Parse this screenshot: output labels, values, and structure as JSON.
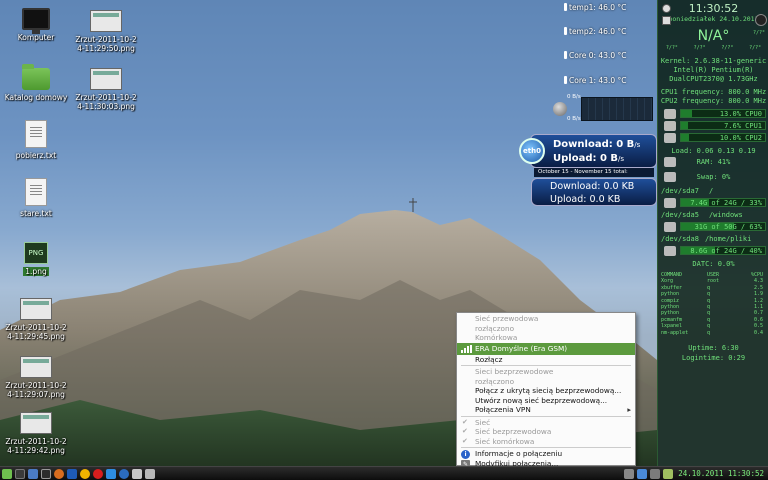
{
  "desktop": {
    "icons": [
      {
        "label": "Komputer"
      },
      {
        "label": "Zrzut-2011-10-2\n4-11:29:50.png"
      },
      {
        "label": "Katalog domowy"
      },
      {
        "label": "Zrzut-2011-10-2\n4-11:30:03.png"
      },
      {
        "label": "pobierz.txt"
      },
      {
        "label": "stare.txt"
      },
      {
        "label": "1.png",
        "badge": "PNG"
      },
      {
        "label": "Zrzut-2011-10-2\n4-11:29:45.png"
      },
      {
        "label": "Zrzut-2011-10-2\n4-11:29:07.png"
      },
      {
        "label": "Zrzut-2011-10-2\n4-11:29:42.png"
      }
    ]
  },
  "temps": {
    "temp1": "temp1: 46.0 °C",
    "temp2": "temp2: 46.0 °C",
    "core0": "Core 0: 43.0 °C",
    "core1": "Core 1: 43.0 °C"
  },
  "network": {
    "speed_down": "0 B/s",
    "speed_up": "0 B/s",
    "iface": "eth0",
    "download": "Download: 0 B",
    "download_unit": "/s",
    "upload": "Upload: 0 B",
    "upload_unit": "/s",
    "period": "October 15 - November 15 total:",
    "total_down": "Download: 0.0 KB",
    "total_up": "Upload: 0.0 KB"
  },
  "conky": {
    "time": "11:30:52",
    "date": "poniedziałek 24.10.2011",
    "weather": "N/A°",
    "weather_small": "?/?°",
    "forecast": [
      "?/?°",
      "?/?°",
      "?/?°",
      "?/?°"
    ],
    "kernel": "Kernel: 2.6.38-11-generic",
    "cpu_name": "Intel(R) Pentium(R)",
    "cpu_model": "DualCPUT2370@ 1.73GHz",
    "cpu1_freq": "CPU1 frequency: 800.0 MHz",
    "cpu2_freq": "CPU2 frequency: 800.0 MHz",
    "cpu0": "13.0% CPU0",
    "cpu1": "7.6% CPU1",
    "cpu2": "10.0% CPU2",
    "load": "Load: 0.06 0.13 0.19",
    "ram": "RAM: 41%",
    "swap": "Swap: 0%",
    "disks": [
      {
        "dev": "/dev/sda7",
        "mount": "/",
        "usage": "7.4G of 24G / 33%",
        "pct": 33
      },
      {
        "dev": "/dev/sda5",
        "mount": "/windows",
        "usage": "31G of 50G / 63%",
        "pct": 63
      },
      {
        "dev": "/dev/sda8",
        "mount": "/home/pliki",
        "usage": "8.6G of 24G / 40%",
        "pct": 40
      }
    ],
    "datc": "DATC: 0.0%",
    "proc_header": [
      "COMMAND",
      "USER",
      "%CPU"
    ],
    "procs": [
      [
        "Xorg",
        "root",
        "4.3"
      ],
      [
        "xbuffer",
        "q",
        "2.5"
      ],
      [
        "python",
        "q",
        "1.9"
      ],
      [
        "compiz",
        "q",
        "1.2"
      ],
      [
        "python",
        "q",
        "1.1"
      ],
      [
        "python",
        "q",
        "0.7"
      ],
      [
        "pcmanfm",
        "q",
        "0.6"
      ],
      [
        "lxpanel",
        "q",
        "0.5"
      ],
      [
        "nm-applet",
        "q",
        "0.4"
      ]
    ],
    "uptime": "Uptime: 6:30",
    "logintime": "Logintime: 0:29"
  },
  "menu": {
    "wired_header": "Sieć przewodowa",
    "disconnected1": "rozłączono",
    "mobile_header": "Komórkowa",
    "era": "ERA Domyślne (Era GSM)",
    "disconnect": "Rozłącz",
    "wireless_header": "Sieci bezprzewodowe",
    "disconnected2": "rozłączono",
    "hidden_wifi": "Połącz z ukrytą siecią bezprzewodową...",
    "new_wifi": "Utwórz nową sieć bezprzewodową...",
    "vpn": "Połączenia VPN",
    "opt_net": "Sieć",
    "opt_wireless": "Sieć bezprzewodowa",
    "opt_mobile": "Sieć komórkowa",
    "info": "Informacje o połączeniu",
    "edit": "Modyfikuj połączenia..."
  },
  "taskbar": {
    "clock": "24.10.2011 11:30:52"
  }
}
